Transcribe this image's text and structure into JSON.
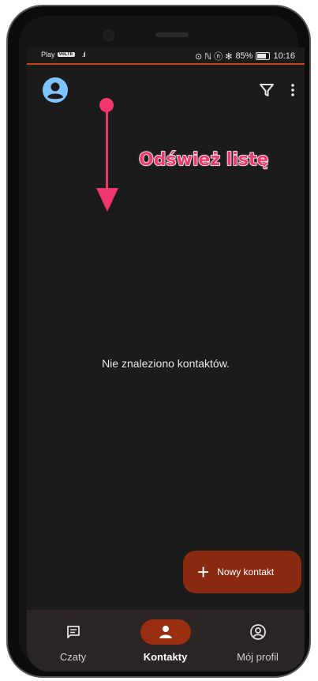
{
  "statusbar": {
    "carrier": "Play",
    "network_badge": "VoLTE",
    "status_icons": "⊙ ℕ ⓝ ✻",
    "battery": "85%",
    "time": "10:16"
  },
  "topbar": {
    "avatar_icon": "account-circle-icon",
    "filter_icon": "filter-icon",
    "menu_icon": "more-vert-icon"
  },
  "hint": {
    "text": "Odśwież listę"
  },
  "content": {
    "empty_message": "Nie znaleziono kontaktów."
  },
  "fab": {
    "label": "Nowy kontakt"
  },
  "bottom_nav": {
    "items": [
      {
        "label": "Czaty",
        "icon": "chat-icon",
        "active": false
      },
      {
        "label": "Kontakty",
        "icon": "person-icon",
        "active": true
      },
      {
        "label": "Mój profil",
        "icon": "profile-icon",
        "active": false
      }
    ]
  },
  "colors": {
    "accent": "#9a2e11",
    "hint": "#f1376e",
    "background": "#1b1b1b"
  }
}
